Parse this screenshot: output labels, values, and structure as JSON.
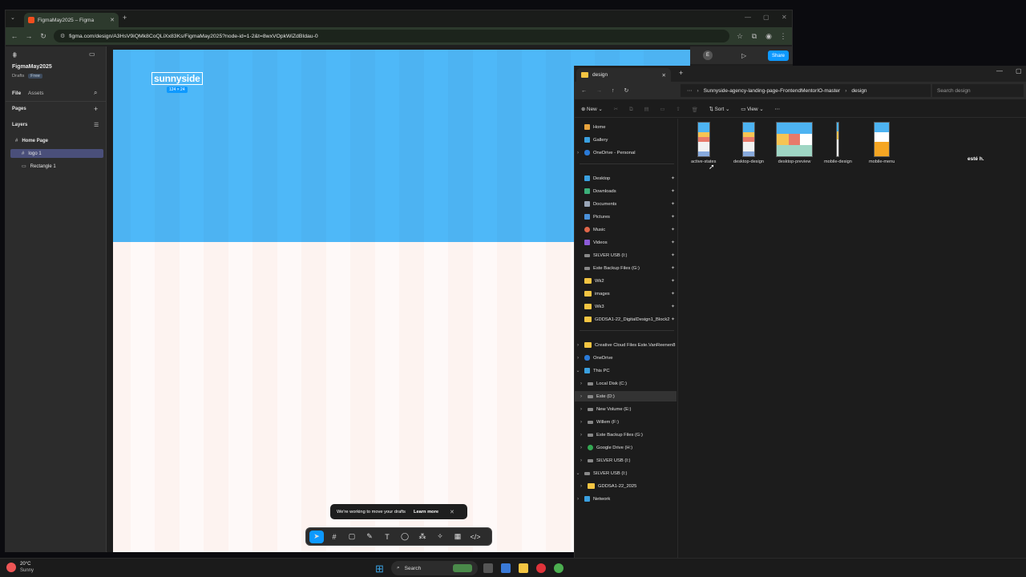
{
  "browser": {
    "tab_title": "FigmaMay2025 – Figma",
    "url": "figma.com/design/A3HsV9iQMk8CoQLiXx83Ks/FigmaMay2025?node-id=1-2&t=8wxVOpkWiZdBIdau-0"
  },
  "figma": {
    "file_name": "FigmaMay2025",
    "drafts": "Drafts",
    "plan": "Free",
    "tab_file": "File",
    "tab_assets": "Assets",
    "pages": "Pages",
    "layers": "Layers",
    "page_name": "Home Page",
    "layer_items": [
      "logo 1",
      "Rectangle 1"
    ],
    "logo_text": "sunnyside",
    "logo_dims": "124 × 24",
    "avatar": "E",
    "share": "Share",
    "toast_text": "We're working to move your drafts",
    "toast_link": "Learn more"
  },
  "explorer": {
    "tab_title": "design",
    "breadcrumb": [
      "Sunnyside-agency-landing-page-FrontendMentorIO-master",
      "design"
    ],
    "search_placeholder": "Search design",
    "cmd_new": "New",
    "cmd_sort": "Sort",
    "cmd_view": "View",
    "nav_top": [
      "Home",
      "Gallery",
      "OneDrive - Personal"
    ],
    "nav_pinned": [
      "Desktop",
      "Downloads",
      "Documents",
      "Pictures",
      "Music",
      "Videos",
      "SILVER USB (I:)",
      "Este Backup Files (G:)",
      "Wk2",
      "images",
      "Wk3",
      "GDDSA1-22_DigitalDesign1_Block2"
    ],
    "nav_tree": [
      "Creative Cloud Files  Este.VanReenen8",
      "OneDrive",
      "This PC",
      "Local Disk (C:)",
      "Este (D:)",
      "New Volume (E:)",
      "Willem (F:)",
      "Este Backup Files (G:)",
      "Google Drive (H:)",
      "SILVER USB (I:)",
      "SILVER USB (I:)",
      "GDDSA1-22_2025",
      "Network"
    ],
    "files": [
      "active-states",
      "desktop-design",
      "desktop-preview",
      "mobile-design",
      "mobile-menu"
    ],
    "side_text": "esté h."
  },
  "taskbar": {
    "temp": "20°C",
    "weather": "Sunny",
    "search": "Search"
  }
}
